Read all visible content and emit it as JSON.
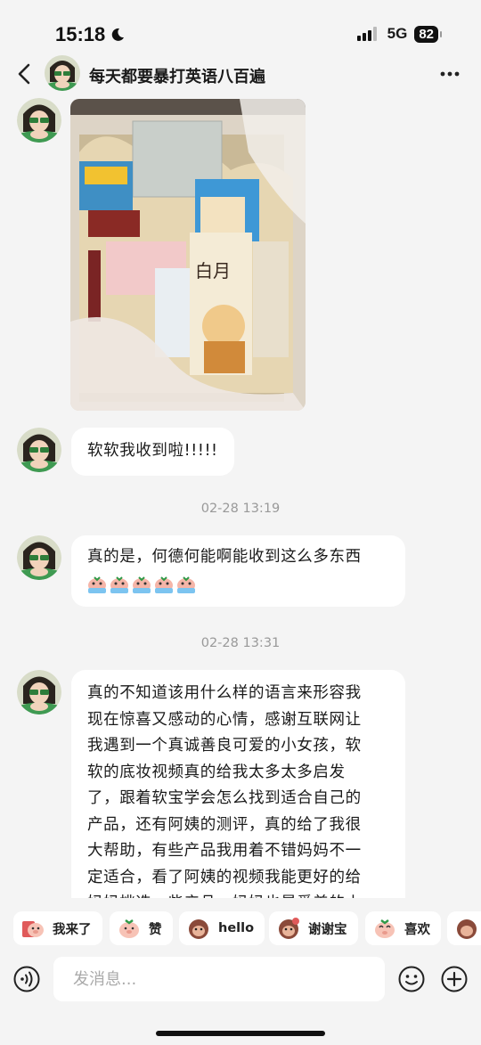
{
  "status_bar": {
    "time": "15:18",
    "network": "5G",
    "battery": "82"
  },
  "header": {
    "title": "每天都要暴打英语八百遍"
  },
  "messages": [
    {
      "type": "image",
      "alt": ""
    },
    {
      "type": "text",
      "text": "软软我收到啦!!!!!"
    },
    {
      "type": "timestamp",
      "text": "02-28 13:19"
    },
    {
      "type": "text",
      "text": "真的是，何德何能啊能收到这么多东西",
      "emoji_count": 5
    },
    {
      "type": "timestamp",
      "text": "02-28 13:31"
    },
    {
      "type": "text",
      "lines": [
        "真的不知道该用什么样的语言来形容我",
        "现在惊喜又感动的心情，感谢互联网让",
        "我遇到一个真诚善良可爱的小女孩，软",
        "软的底妆视频真的给我太多太多启发",
        "了，跟着软宝学会怎么找到适合自己的",
        "产品，还有阿姨的测评，真的给了我很",
        "大帮助，有些产品我用着不错妈妈不一",
        "定适合，看了阿姨的视频我能更好的给",
        "妈妈挑选一些产品，妈妈也是爱美的小"
      ]
    }
  ],
  "quick_replies": [
    {
      "label": "我来了",
      "icon": "pig-waving-icon"
    },
    {
      "label": "赞",
      "icon": "pig-thumbs-up-icon"
    },
    {
      "label": "hello",
      "icon": "monkey-hello-icon"
    },
    {
      "label": "谢谢宝",
      "icon": "monkey-thanks-icon"
    },
    {
      "label": "喜欢",
      "icon": "pig-love-icon"
    }
  ],
  "input": {
    "placeholder": "发消息..."
  },
  "colors": {
    "background": "#f4f4f4",
    "bubble": "#ffffff",
    "timestamp": "#999999"
  }
}
